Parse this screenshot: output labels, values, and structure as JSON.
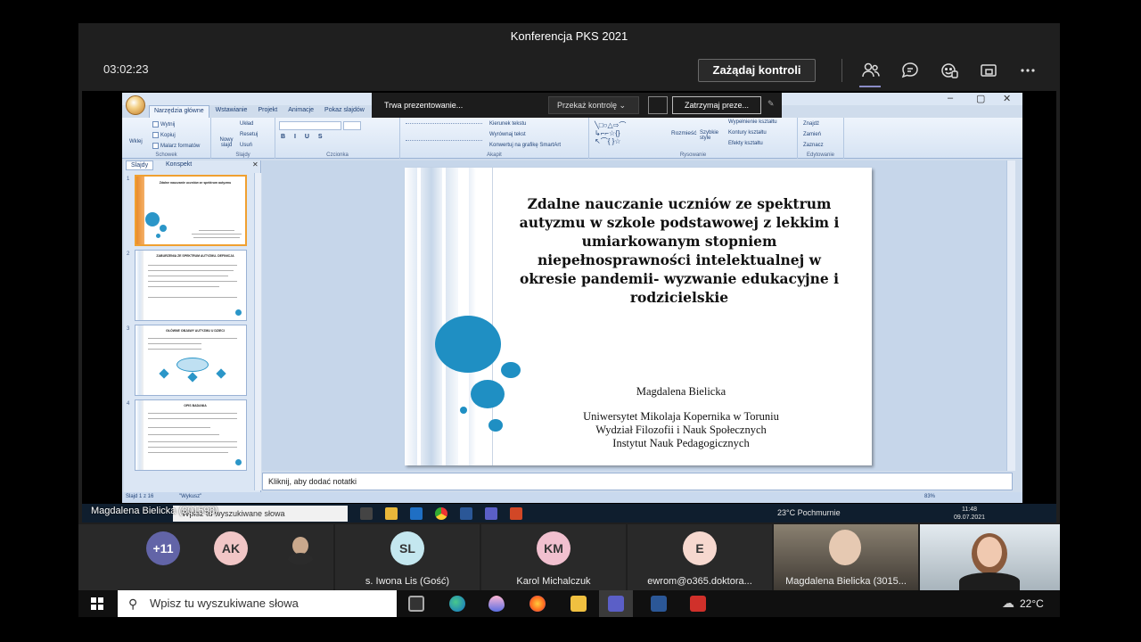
{
  "teams": {
    "meeting_title": "Konferencja PKS 2021",
    "timer": "03:02:23",
    "request_control": "Zażądaj kontroli",
    "icons": [
      "people-icon",
      "chat-icon",
      "reactions-icon",
      "share-tray-icon",
      "more-icon"
    ]
  },
  "presenting_bar": {
    "status": "Trwa prezentowanie...",
    "give_control": "Przekaż kontrolę",
    "stop": "Zatrzymaj preze..."
  },
  "ppt": {
    "tabs": [
      "Narzędzia główne",
      "Wstawianie",
      "Projekt",
      "Animacje",
      "Pokaz slajdów"
    ],
    "groups": [
      {
        "label": "Schowek",
        "items": [
          "Wklej",
          "Wytnij",
          "Kopiuj",
          "Malarz formatów"
        ]
      },
      {
        "label": "Slajdy",
        "items": [
          "Nowy slajd",
          "Układ",
          "Resetuj",
          "Usuń"
        ]
      },
      {
        "label": "Czcionka",
        "items": []
      },
      {
        "label": "Akapit",
        "items": [
          "Kierunek tekstu",
          "Wyrównaj tekst",
          "Konwertuj na grafikę SmartArt"
        ]
      },
      {
        "label": "Rysowanie",
        "items": [
          "Rozmieść",
          "Szybkie style",
          "Wypełnienie kształtu",
          "Kontury kształtu",
          "Efekty kształtu"
        ]
      },
      {
        "label": "Edytowanie",
        "items": [
          "Znajdź",
          "Zamień",
          "Zaznacz"
        ]
      }
    ],
    "pane_tabs": [
      "Slajdy",
      "Konspekt"
    ],
    "thumbnails": [
      {
        "num": "1",
        "title": "Zdalne nauczanie uczniów ze spektrum autyzmu"
      },
      {
        "num": "2",
        "title": "ZABURZENIA ZE SPEKTRUM AUTYZMU- DEFINICJA"
      },
      {
        "num": "3",
        "title": "GŁÓWNE OBJAWY AUTYZMU U DZIECI"
      },
      {
        "num": "4",
        "title": "OPIS BADANIA"
      }
    ],
    "slide": {
      "title": "Zdalne nauczanie uczniów ze spektrum autyzmu w szkole podstawowej z lekkim i umiarkowanym stopniem niepełnosprawności intelektualnej w okresie pandemii- wyzwanie edukacyjne i rodzicielskie",
      "author": "Magdalena Bielicka",
      "affil1": "Uniwersytet Mikolaja Kopernika w Toruniu",
      "affil2": "Wydział Filozofii i Nauk Społecznych",
      "affil3": "Instytut Nauk Pedagogicznych"
    },
    "notes_placeholder": "Kliknij, aby dodać notatki",
    "status_slide": "Slajd 1 z 16",
    "status_theme": "\"Wykusz\"",
    "zoom": "83%"
  },
  "remote_taskbar": {
    "search": "Wpisz tu wyszukiwane słowa",
    "weather": "23°C  Pochmurnie",
    "time": "11:48",
    "date": "09.07.2021"
  },
  "presenter_label": "Magdalena Bielicka (301598)",
  "participants": [
    {
      "initials": "+11",
      "name": "",
      "color": "#6264a7"
    },
    {
      "initials": "AK",
      "name": "",
      "color": "#f1c6c6"
    },
    {
      "initials": "",
      "name": "",
      "color": "#7a6a5a"
    },
    {
      "initials": "SL",
      "name": "s. Iwona Lis (Gość)",
      "color": "#c4e7ef"
    },
    {
      "initials": "KM",
      "name": "Karol Michalczuk",
      "color": "#f1c0cf"
    },
    {
      "initials": "E",
      "name": "ewrom@o365.doktora...",
      "color": "#f6d8cf"
    },
    {
      "initials": "",
      "name": "Magdalena Bielicka (3015...",
      "color": "#6b5f55"
    },
    {
      "initials": "",
      "name": "",
      "color": "#cfd8e0"
    }
  ],
  "local_taskbar": {
    "search": "Wpisz tu wyszukiwane słowa",
    "weather": "22°C"
  }
}
